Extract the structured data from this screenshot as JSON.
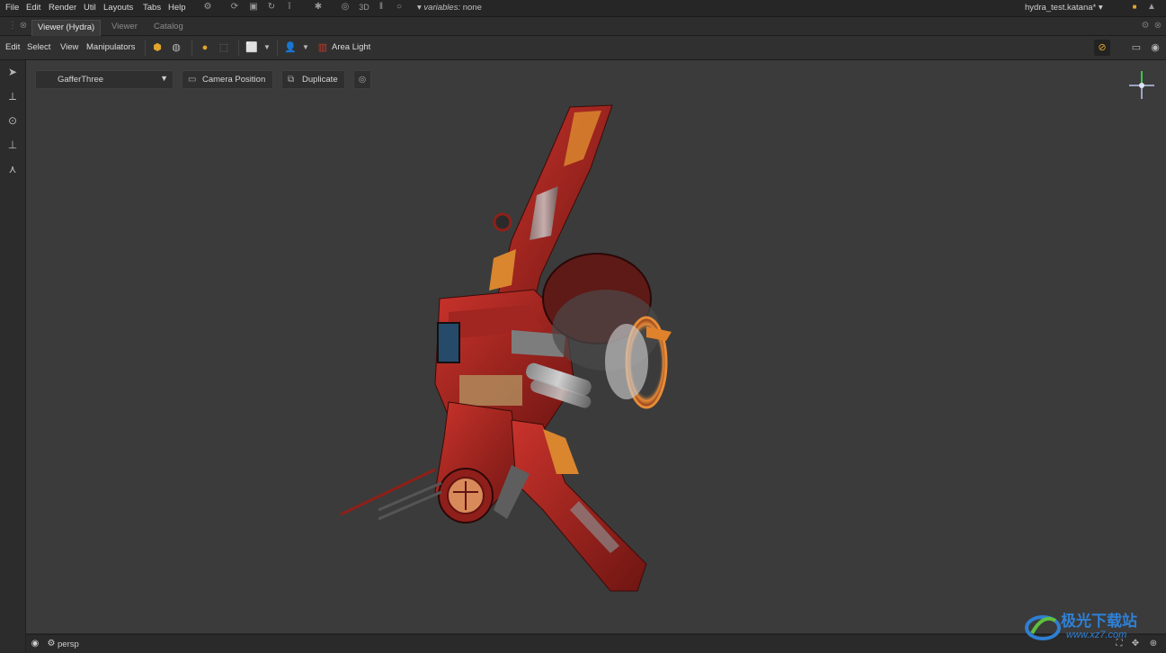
{
  "menubar": {
    "items": [
      "File",
      "Edit",
      "Render",
      "Util",
      "Layouts",
      "Tabs",
      "Help"
    ],
    "mode_3d": "3D",
    "variables_label": "variables:",
    "variables_value": "none",
    "project_name": "hydra_test.katana*"
  },
  "tabs": [
    {
      "label": "Viewer (Hydra)",
      "active": true
    },
    {
      "label": "Viewer",
      "active": false
    },
    {
      "label": "Catalog",
      "active": false
    }
  ],
  "viewer_menu": [
    "Edit",
    "Select",
    "View",
    "Manipulators"
  ],
  "viewer_toolbar": {
    "light_type_label": "Area Light"
  },
  "viewport_controls": {
    "gaffer_select": "GafferThree",
    "camera_position_label": "Camera Position",
    "duplicate_label": "Duplicate"
  },
  "status": {
    "camera": "persp"
  },
  "watermark": {
    "name": "极光下载站",
    "url": "www.xz7.com"
  },
  "colors": {
    "accent_yellow": "#e0a52a",
    "ship_red": "#b3241f",
    "viewport_bg": "#3b3b3b"
  }
}
